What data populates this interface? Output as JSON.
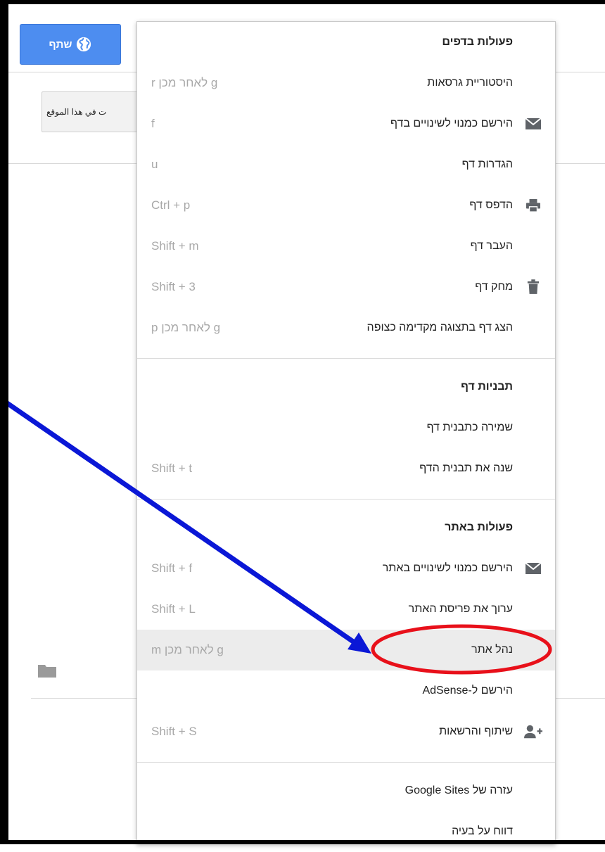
{
  "topbar": {
    "share_label": "שתף",
    "search_button_label": "ت في هذا الموقع"
  },
  "menu": {
    "sections": [
      {
        "heading": "פעולות בדפים",
        "items": [
          {
            "label": "היסטוריית גרסאות",
            "shortcut": "g לאחר מכן r",
            "icon": ""
          },
          {
            "label": "הירשם כמנוי לשינויים בדף",
            "shortcut": "f",
            "icon": "envelope-icon"
          },
          {
            "label": "הגדרות דף",
            "shortcut": "u",
            "icon": ""
          },
          {
            "label": "הדפס דף",
            "shortcut": "Ctrl + p",
            "icon": "printer-icon"
          },
          {
            "label": "העבר דף",
            "shortcut": "Shift + m",
            "icon": ""
          },
          {
            "label": "מחק דף",
            "shortcut": "Shift + 3",
            "icon": "trash-icon"
          },
          {
            "label": "הצג דף בתצוגה מקדימה כצופה",
            "shortcut": "g לאחר מכן p",
            "icon": ""
          }
        ]
      },
      {
        "heading": "תבניות דף",
        "items": [
          {
            "label": "שמירה כתבנית דף",
            "shortcut": "",
            "icon": ""
          },
          {
            "label": "שנה את תבנית הדף",
            "shortcut": "Shift + t",
            "icon": ""
          }
        ]
      },
      {
        "heading": "פעולות באתר",
        "items": [
          {
            "label": "הירשם כמנוי לשינויים באתר",
            "shortcut": "Shift + f",
            "icon": "envelope-icon"
          },
          {
            "label": "ערוך את פריסת האתר",
            "shortcut": "Shift + L",
            "icon": ""
          },
          {
            "label": "נהל אתר",
            "shortcut": "g לאחר מכן m",
            "icon": "",
            "highlighted": true
          },
          {
            "label": "הירשם ל-AdSense",
            "shortcut": "",
            "icon": ""
          },
          {
            "label": "שיתוף והרשאות",
            "shortcut": "Shift + S",
            "icon": "add-person-icon"
          }
        ]
      },
      {
        "heading": "",
        "items": [
          {
            "label": "עזרה של Google Sites",
            "shortcut": "",
            "icon": ""
          },
          {
            "label": "דווח על בעיה",
            "shortcut": "",
            "icon": ""
          }
        ]
      }
    ]
  },
  "annotation": {
    "arrow_color": "#0a17d6",
    "ellipse_color": "#e8101a"
  },
  "colors": {
    "share_button": "#4d8df0",
    "highlight_row": "#ececec",
    "shortcut_text": "#a8a8a8"
  }
}
